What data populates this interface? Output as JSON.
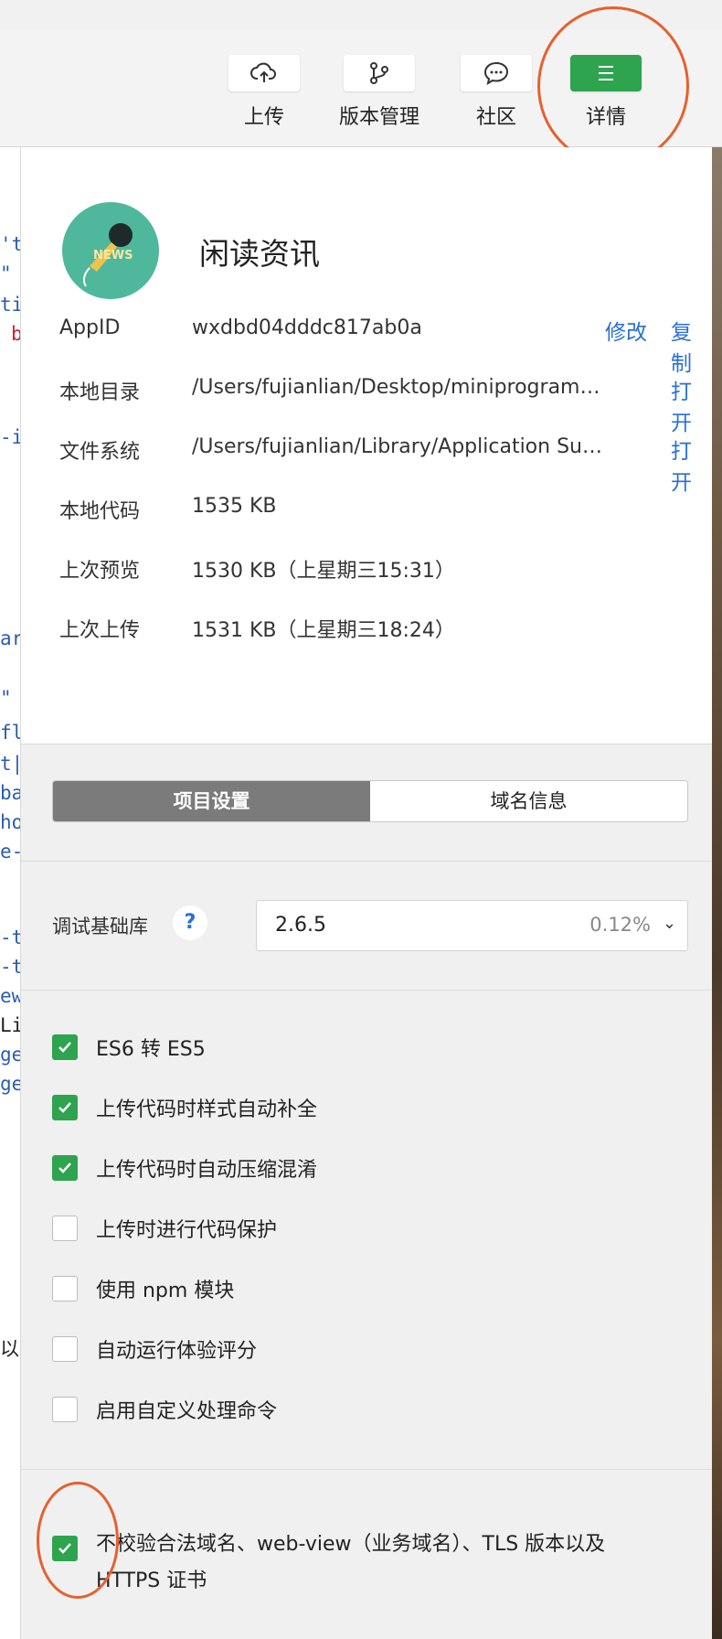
{
  "toolbar": {
    "buttons": [
      {
        "label": "上传",
        "icon": "cloud-upload-icon"
      },
      {
        "label": "版本管理",
        "icon": "branch-icon"
      },
      {
        "label": "社区",
        "icon": "chat-icon"
      },
      {
        "label": "详情",
        "icon": "menu-icon"
      }
    ]
  },
  "editor": {
    "fragments": [
      "'t",
      "\"",
      "ti",
      "b",
      "-i",
      "ar",
      "\"",
      "fl",
      "t|",
      "ba",
      "ho",
      "e-",
      "-t",
      "-t",
      "ew",
      "Li",
      "ge",
      "ge",
      "以",
      ""
    ]
  },
  "app": {
    "name": "闲读资讯",
    "avatar_text": "NEWS"
  },
  "info": {
    "appid_label": "AppID",
    "appid_value": "wxdbd04dddc817ab0a",
    "appid_edit": "修改",
    "appid_copy": "复制",
    "localdir_label": "本地目录",
    "localdir_value": "/Users/fujianlian/Desktop/miniprogram/l...",
    "localdir_open": "打开",
    "fs_label": "文件系统",
    "fs_value": "/Users/fujianlian/Library/Application Sup...",
    "fs_open": "打开",
    "code_label": "本地代码",
    "code_value": "1535 KB",
    "preview_label": "上次预览",
    "preview_value": "1530 KB（上星期三15:31）",
    "upload_label": "上次上传",
    "upload_value": "1531 KB（上星期三18:24）"
  },
  "tabs": {
    "project": "项目设置",
    "domain": "域名信息"
  },
  "debug": {
    "label": "调试基础库",
    "help": "?",
    "version": "2.6.5",
    "usage": "0.12%",
    "chevron": "⌄"
  },
  "options": [
    {
      "label": "ES6 转 ES5",
      "checked": true
    },
    {
      "label": "上传代码时样式自动补全",
      "checked": true
    },
    {
      "label": "上传代码时自动压缩混淆",
      "checked": true
    },
    {
      "label": "上传时进行代码保护",
      "checked": false
    },
    {
      "label": "使用 npm 模块",
      "checked": false
    },
    {
      "label": "自动运行体验评分",
      "checked": false
    },
    {
      "label": "启用自定义处理命令",
      "checked": false
    }
  ],
  "last_option": {
    "label": "不校验合法域名、web-view（业务域名）、TLS 版本以及 HTTPS 证书",
    "checked": true
  },
  "colors": {
    "accent_green": "#2ea44f",
    "link_blue": "#2a6fd8",
    "highlight_circle": "#e5612f",
    "active_tab": "#7b7b7b"
  }
}
